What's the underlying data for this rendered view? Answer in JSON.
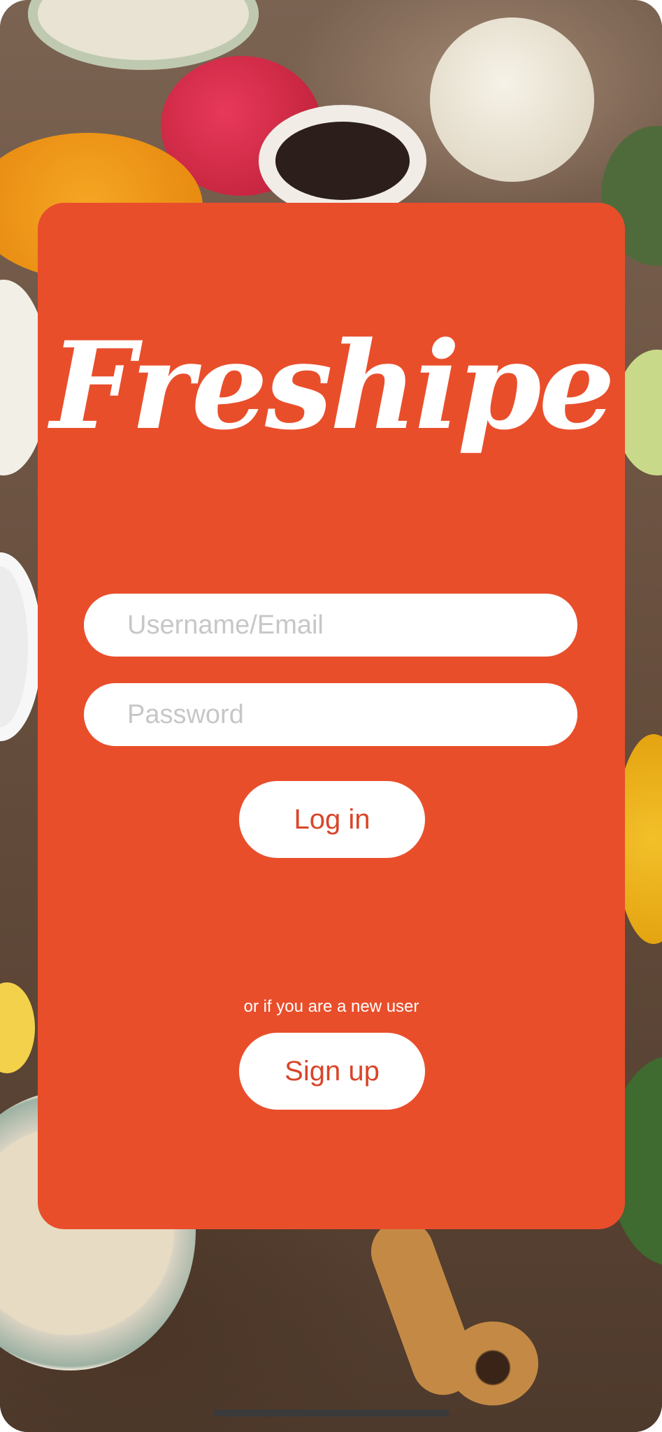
{
  "app": {
    "logo_text": "Freshipe"
  },
  "login_form": {
    "username_placeholder": "Username/Email",
    "password_placeholder": "Password",
    "login_label": "Log in"
  },
  "signup": {
    "prompt": "or if you are a new user",
    "button_label": "Sign up"
  },
  "colors": {
    "card_background": "#e94e2b",
    "button_text": "#d9452a",
    "field_background": "#ffffff",
    "placeholder_text": "#c7c7c7"
  }
}
